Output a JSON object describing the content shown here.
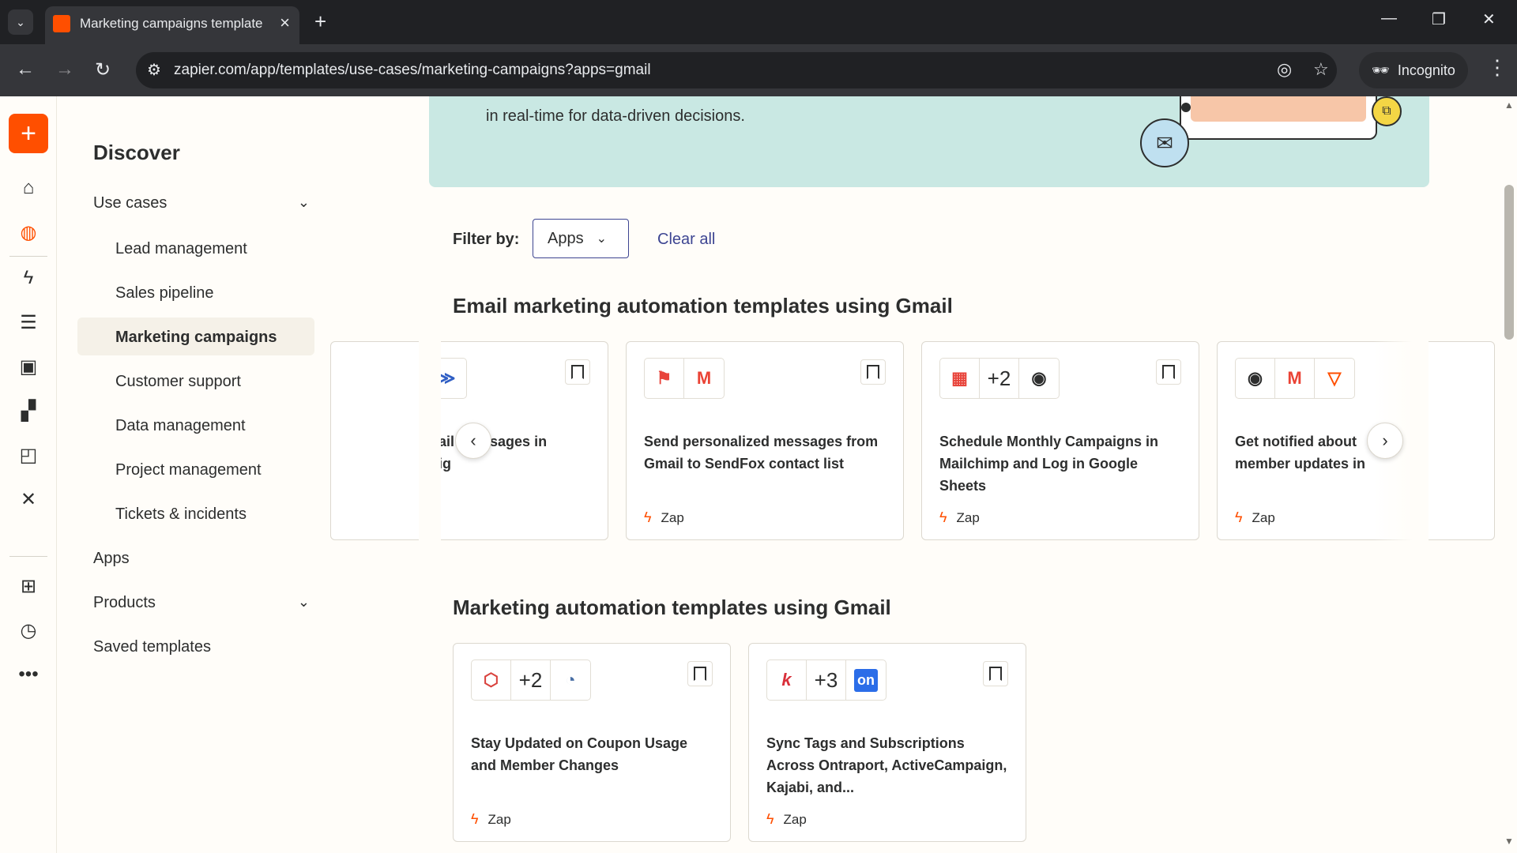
{
  "browser": {
    "tab_title": "Marketing campaigns template",
    "url": "zapier.com/app/templates/use-cases/marketing-campaigns?apps=gmail",
    "incognito_label": "Incognito"
  },
  "sidebar": {
    "heading": "Discover",
    "use_cases_label": "Use cases",
    "use_cases": [
      "Lead management",
      "Sales pipeline",
      "Marketing campaigns",
      "Customer support",
      "Data management",
      "Project management",
      "Tickets & incidents"
    ],
    "apps_label": "Apps",
    "products_label": "Products",
    "saved_label": "Saved templates"
  },
  "banner": {
    "text": "in real-time for data-driven decisions."
  },
  "filter": {
    "label": "Filter by:",
    "select_value": "Apps",
    "clear_label": "Clear all"
  },
  "section1": {
    "heading": "Email marketing automation templates using Gmail",
    "cards": [
      {
        "title_a": "ail",
        "title_b": "sages in",
        "title_c": "ig",
        "type": ""
      },
      {
        "title": "Send personalized messages from Gmail to SendFox contact list",
        "type": "Zap"
      },
      {
        "title": "Schedule Monthly Campaigns in Mailchimp and Log in Google Sheets",
        "plus": "+2",
        "type": "Zap"
      },
      {
        "title": "Get notified about member updates in",
        "type": "Zap"
      }
    ]
  },
  "section2": {
    "heading": "Marketing automation templates using Gmail",
    "cards": [
      {
        "title": "Stay Updated on Coupon Usage and Member Changes",
        "plus": "+2",
        "type": "Zap"
      },
      {
        "title": "Sync Tags and Subscriptions Across Ontraport, ActiveCampaign, Kajabi, and...",
        "plus": "+3",
        "type": "Zap",
        "on_badge": "on"
      }
    ]
  },
  "colors": {
    "brand": "#ff4f00",
    "link": "#3d4592",
    "banner": "#c9e8e3"
  }
}
